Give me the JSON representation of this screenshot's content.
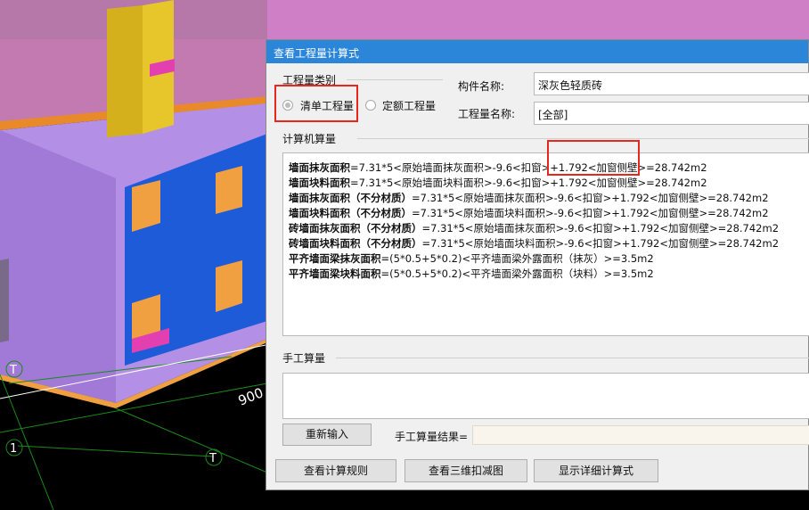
{
  "dialog": {
    "title": "查看工程量计算式",
    "category_group_label": "工程量类别",
    "radio_bill": "清单工程量",
    "radio_quota": "定额工程量",
    "component_name_label": "构件名称:",
    "component_name_value": "深灰色轻质砖",
    "quantity_name_label": "工程量名称:",
    "quantity_name_value": "[全部]",
    "computer_calc_label": "计算机算量",
    "calc_lines": [
      {
        "name": "墙面抹灰面积",
        "formula": "=7.31*5<原始墙面抹灰面积>-9.6<扣窗>+1.792<加窗侧壁>=28.742m2"
      },
      {
        "name": "墙面块料面积",
        "formula": "=7.31*5<原始墙面块料面积>-9.6<扣窗>+1.792<加窗侧壁>=28.742m2"
      },
      {
        "name": "墙面抹灰面积（不分材质）",
        "formula": "=7.31*5<原始墙面抹灰面积>-9.6<扣窗>+1.792<加窗侧壁>=28.742m2"
      },
      {
        "name": "墙面块料面积（不分材质）",
        "formula": "=7.31*5<原始墙面块料面积>-9.6<扣窗>+1.792<加窗侧壁>=28.742m2"
      },
      {
        "name": "砖墙面抹灰面积（不分材质）",
        "formula": "=7.31*5<原始墙面抹灰面积>-9.6<扣窗>+1.792<加窗侧壁>=28.742m2"
      },
      {
        "name": "砖墙面块料面积（不分材质）",
        "formula": "=7.31*5<原始墙面块料面积>-9.6<扣窗>+1.792<加窗侧壁>=28.742m2"
      },
      {
        "name": "平齐墙面梁抹灰面积",
        "formula": "=(5*0.5+5*0.2)<平齐墙面梁外露面积（抹灰）>=3.5m2"
      },
      {
        "name": "平齐墙面梁块料面积",
        "formula": "=(5*0.5+5*0.2)<平齐墙面梁外露面积（块料）>=3.5m2"
      }
    ],
    "manual_calc_label": "手工算量",
    "reenter_button": "重新输入",
    "manual_result_label": "手工算量结果=",
    "view_rules_button": "查看计算规则",
    "view_3d_button": "查看三维扣减图",
    "show_detail_button": "显示详细计算式"
  },
  "scene": {
    "axis_labels": [
      "T",
      "1",
      "T"
    ],
    "dimension_text": "900"
  },
  "colors": {
    "titlebar": "#2b86d9",
    "highlight": "#e8261c",
    "wall": "#a98ae0",
    "window": "#1e5bd8",
    "column": "#d4b11c"
  }
}
